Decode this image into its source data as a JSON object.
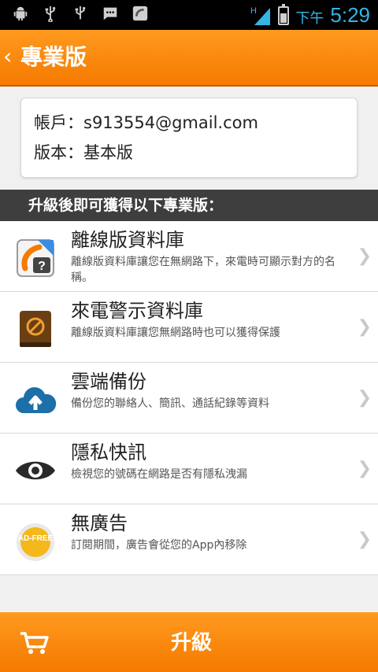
{
  "status_bar": {
    "ampm": "下午",
    "time": "5:29",
    "network": "H"
  },
  "action_bar": {
    "title": "專業版"
  },
  "account": {
    "account_line": "帳戶：s913554@gmail.com",
    "version_line": "版本：基本版"
  },
  "section_header": "升級後即可獲得以下專業版：",
  "features": [
    {
      "icon": "offline-database-icon",
      "title": "離線版資料庫",
      "desc": "離線版資料庫讓您在無網路下，來電時可顯示對方的名稱。"
    },
    {
      "icon": "warning-database-icon",
      "title": "來電警示資料庫",
      "desc": "離線版資料庫讓您無網路時也可以獲得保護"
    },
    {
      "icon": "cloud-upload-icon",
      "title": "雲端備份",
      "desc": "備份您的聯絡人、簡訊、通話紀錄等資料"
    },
    {
      "icon": "eye-icon",
      "title": "隱私快訊",
      "desc": "檢視您的號碼在網路是否有隱私洩漏"
    },
    {
      "icon": "ad-free-badge-icon",
      "title": "無廣告",
      "desc": "訂閱期間，廣告會從您的App內移除",
      "badge": "AD-FREE"
    }
  ],
  "bottom_bar": {
    "upgrade_label": "升級"
  },
  "colors": {
    "orange": "#f57a00",
    "dark_header": "#3e3e3e",
    "status_blue": "#33b5e5"
  }
}
